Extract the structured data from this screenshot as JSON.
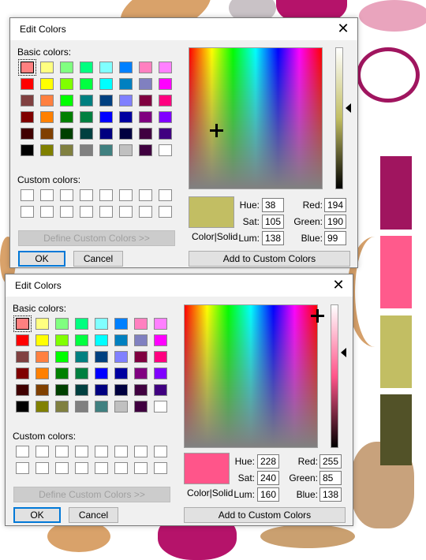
{
  "dialogs": [
    {
      "title": "Edit Colors",
      "basic_colors_label": "Basic colors:",
      "custom_colors_label": "Custom colors:",
      "define_custom_button": "Define Custom Colors >>",
      "ok_button": "OK",
      "cancel_button": "Cancel",
      "add_custom_button": "Add to Custom Colors",
      "color_solid_label": "Color|Solid",
      "hue_label": "Hue:",
      "sat_label": "Sat:",
      "lum_label": "Lum:",
      "red_label": "Red:",
      "green_label": "Green:",
      "blue_label": "Blue:",
      "hue": "38",
      "sat": "105",
      "lum": "138",
      "red": "194",
      "green": "190",
      "blue": "99",
      "preview_color": "#c2be63"
    },
    {
      "title": "Edit Colors",
      "basic_colors_label": "Basic colors:",
      "custom_colors_label": "Custom colors:",
      "define_custom_button": "Define Custom Colors >>",
      "ok_button": "OK",
      "cancel_button": "Cancel",
      "add_custom_button": "Add to Custom Colors",
      "color_solid_label": "Color|Solid",
      "hue_label": "Hue:",
      "sat_label": "Sat:",
      "lum_label": "Lum:",
      "red_label": "Red:",
      "green_label": "Green:",
      "blue_label": "Blue:",
      "hue": "228",
      "sat": "240",
      "lum": "160",
      "red": "255",
      "green": "85",
      "blue": "138",
      "preview_color": "#ff558a"
    }
  ],
  "basic_colors": [
    "#ff8080",
    "#ffff80",
    "#80ff80",
    "#00ff80",
    "#80ffff",
    "#0080ff",
    "#ff80c0",
    "#ff80ff",
    "#ff0000",
    "#ffff00",
    "#80ff00",
    "#00ff40",
    "#00ffff",
    "#0080c0",
    "#8080c0",
    "#ff00ff",
    "#804040",
    "#ff8040",
    "#00ff00",
    "#008080",
    "#004080",
    "#8080ff",
    "#800040",
    "#ff0080",
    "#800000",
    "#ff8000",
    "#008000",
    "#008040",
    "#0000ff",
    "#0000a0",
    "#800080",
    "#8000ff",
    "#400000",
    "#804000",
    "#004000",
    "#004040",
    "#000080",
    "#000040",
    "#400040",
    "#400080",
    "#000000",
    "#808000",
    "#808040",
    "#808080",
    "#408080",
    "#c0c0c0",
    "#400040",
    "#ffffff"
  ],
  "background_swatches": [
    "#a0155f",
    "#ff5a8c",
    "#c2be63",
    "#525228"
  ]
}
